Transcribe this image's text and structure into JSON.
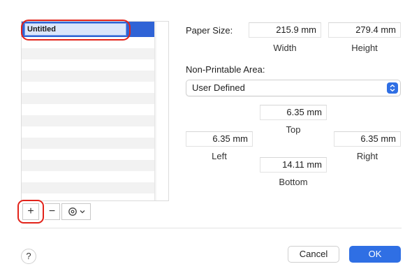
{
  "sizes_list": {
    "selected_name": "Untitled"
  },
  "list_controls": {
    "add_label": "+",
    "remove_label": "−"
  },
  "paper_size": {
    "label": "Paper Size:",
    "width_value": "215.9 mm",
    "width_label": "Width",
    "height_value": "279.4 mm",
    "height_label": "Height"
  },
  "non_printable": {
    "label": "Non-Printable Area:",
    "popup_value": "User Defined",
    "top_value": "6.35 mm",
    "top_label": "Top",
    "left_value": "6.35 mm",
    "left_label": "Left",
    "right_value": "6.35 mm",
    "right_label": "Right",
    "bottom_value": "14.11 mm",
    "bottom_label": "Bottom"
  },
  "footer": {
    "help_label": "?",
    "cancel_label": "Cancel",
    "ok_label": "OK"
  },
  "colors": {
    "accent": "#2f6fe4",
    "highlight_ring": "#e2231a"
  }
}
